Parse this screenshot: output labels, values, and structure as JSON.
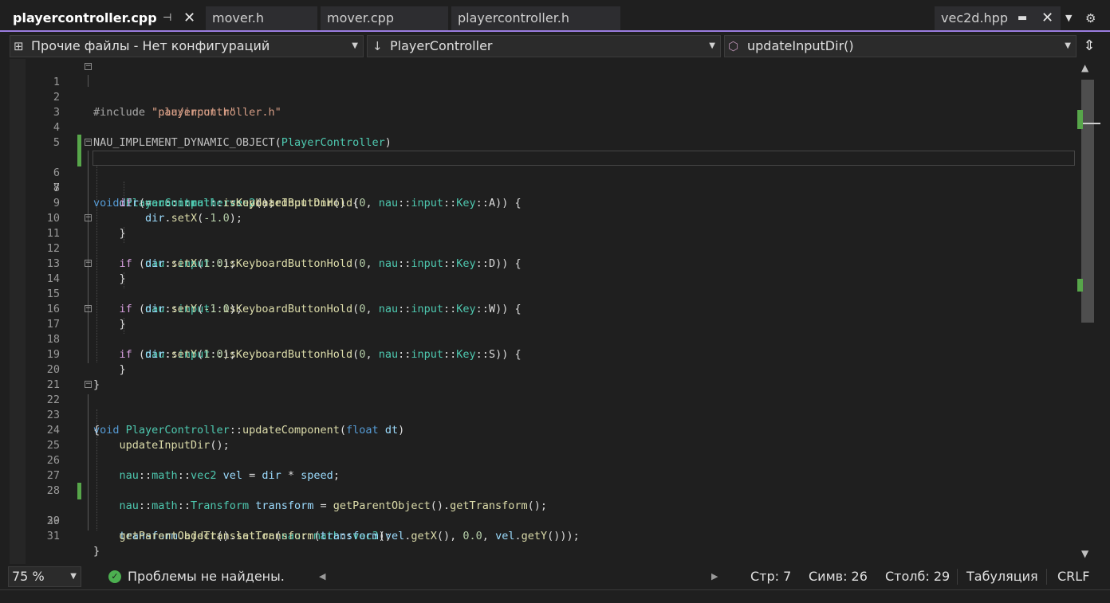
{
  "tabs": [
    {
      "label": "playercontroller.cpp",
      "active": true
    },
    {
      "label": "mover.h",
      "active": false
    },
    {
      "label": "mover.cpp",
      "active": false
    },
    {
      "label": "playercontroller.h",
      "active": false
    },
    {
      "label": "vec2d.hpp",
      "active": false,
      "preview": true
    }
  ],
  "nav": {
    "project": "Прочие файлы - Нет конфигураций",
    "scope": "PlayerController",
    "member": "updateInputDir()"
  },
  "editor": {
    "current_line": 7,
    "lines": [
      {
        "n": "1"
      },
      {
        "n": "2"
      },
      {
        "n": "3"
      },
      {
        "n": "4"
      },
      {
        "n": "5"
      },
      {
        "n": "6"
      },
      {
        "n": "7"
      },
      {
        "n": "8"
      },
      {
        "n": "9"
      },
      {
        "n": "10"
      },
      {
        "n": "11"
      },
      {
        "n": "12"
      },
      {
        "n": "13"
      },
      {
        "n": "14"
      },
      {
        "n": "15"
      },
      {
        "n": "16"
      },
      {
        "n": "17"
      },
      {
        "n": "18"
      },
      {
        "n": "19"
      },
      {
        "n": "20"
      },
      {
        "n": "21"
      },
      {
        "n": "22"
      },
      {
        "n": "23"
      },
      {
        "n": "24"
      },
      {
        "n": "25"
      },
      {
        "n": "26"
      },
      {
        "n": "27"
      },
      {
        "n": "28"
      },
      {
        "n": "29"
      },
      {
        "n": "30"
      },
      {
        "n": "31"
      }
    ],
    "changed_lines": [
      6,
      7,
      29
    ]
  },
  "code": {
    "inc": "#include",
    "inc1_file": "\"playercontroller.h\"",
    "inc2_file": "\"nau/input.h\"",
    "macro": "NAU_IMPLEMENT_DYNAMIC_OBJECT",
    "pc": "PlayerController",
    "kw_void": "void",
    "kw_if": "if",
    "kw_float": "float",
    "fn_update_input_dir": "updateInputDir",
    "fn_update_component": "updateComponent",
    "dir": "dir",
    "nau": "nau",
    "math": "math",
    "input": "input",
    "vec2": "vec2",
    "vec3": "vec3",
    "is_hold": "isKeyboardButtonHold",
    "key_type": "Key",
    "key_a": "A",
    "key_d": "D",
    "key_w": "W",
    "key_s": "S",
    "zero": "0",
    "set_x": "setX",
    "set_y": "setY",
    "neg_one": "-1.0",
    "pos_one": "1.0",
    "zero_f": "0.0",
    "dt": "dt",
    "vel": "vel",
    "speed": "speed",
    "transform_type": "Transform",
    "transform_var": "transform",
    "get_parent": "getParentObject",
    "get_transform": "getTransform",
    "add_translation": "addTranslation",
    "get_x": "getX",
    "get_y": "getY",
    "set_transform": "setTransform"
  },
  "status": {
    "zoom": "75 %",
    "problems": "Проблемы не найдены.",
    "line": "Стр: 7",
    "char": "Симв: 26",
    "col": "Столб: 29",
    "indent": "Табуляция",
    "eol": "CRLF"
  },
  "icons": {
    "tab_pin": "pin-icon",
    "tab_close": "close-icon",
    "project": "project-icon",
    "scope": "scope-arrow-icon",
    "member": "method-cube-icon",
    "ok": "check-circle-icon"
  },
  "colors": {
    "accent": "#9b7de0",
    "keyword": "#569cd6",
    "control": "#d8a0df",
    "string": "#d69d85",
    "type": "#4ec9b0",
    "function": "#dcdcaa",
    "number": "#b5cea8",
    "changed": "#57a64a"
  }
}
